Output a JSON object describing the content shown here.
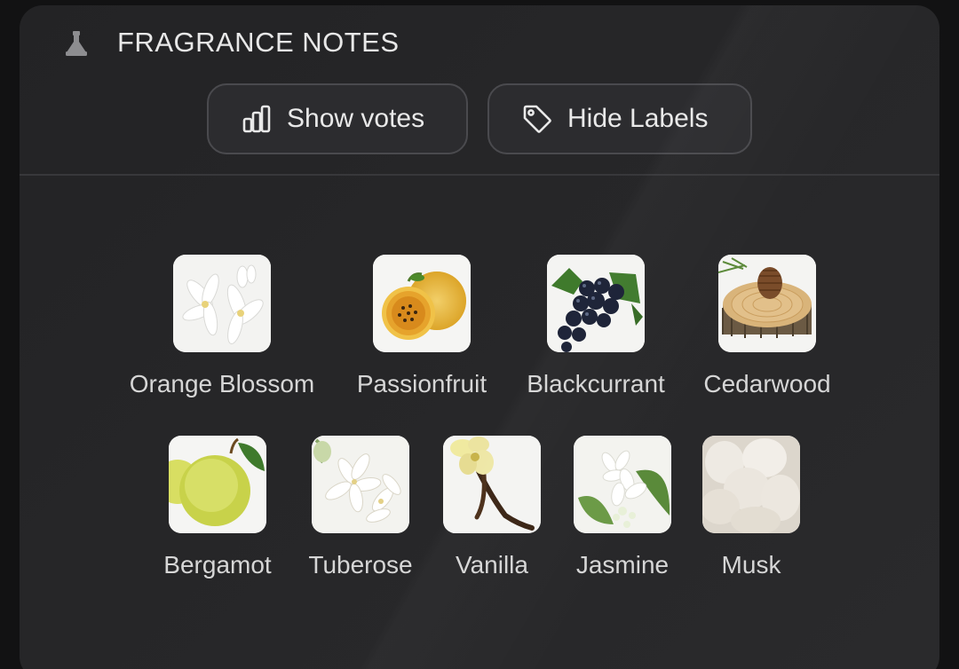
{
  "section": {
    "title": "FRAGRANCE NOTES",
    "icon": "perfume-bottle-icon"
  },
  "buttons": {
    "show_votes": {
      "label": "Show votes",
      "icon": "bar-chart-icon"
    },
    "hide_labels": {
      "label": "Hide Labels",
      "icon": "tag-icon"
    }
  },
  "notes": [
    {
      "label": "Orange Blossom",
      "image": "orange-blossom-image"
    },
    {
      "label": "Passionfruit",
      "image": "passionfruit-image"
    },
    {
      "label": "Blackcurrant",
      "image": "blackcurrant-image"
    },
    {
      "label": "Cedarwood",
      "image": "cedarwood-image"
    },
    {
      "label": "Bergamot",
      "image": "bergamot-image"
    },
    {
      "label": "Tuberose",
      "image": "tuberose-image"
    },
    {
      "label": "Vanilla",
      "image": "vanilla-image"
    },
    {
      "label": "Jasmine",
      "image": "jasmine-image"
    },
    {
      "label": "Musk",
      "image": "musk-image"
    }
  ],
  "colors": {
    "background": "#121213",
    "card": "#252527",
    "button": "#2c2c2f",
    "button_border": "#4a4a4e",
    "text": "#e6e6e6"
  }
}
